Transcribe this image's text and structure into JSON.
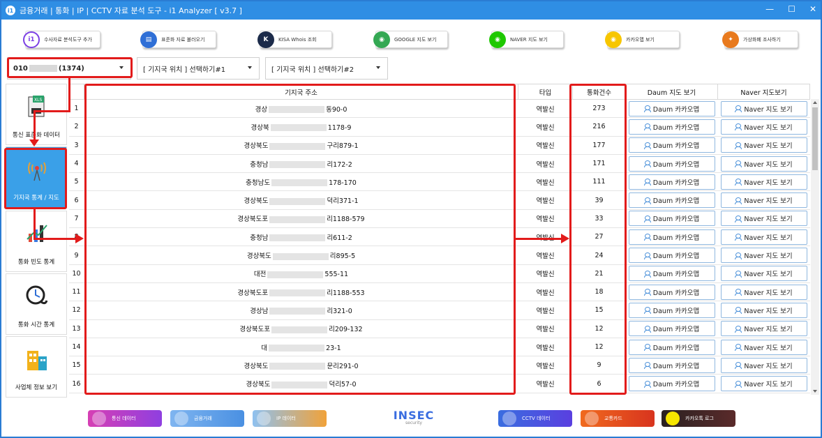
{
  "window": {
    "title": "금융거래 | 통화 | IP | CCTV 자료 분석 도구 - i1 Analyzer [ v3.7 ]",
    "app_icon": "i1",
    "controls": [
      "—",
      "☐",
      "✕"
    ]
  },
  "toolbar": {
    "buttons": [
      {
        "label": "수사자료 분석도구 추가",
        "icon": "i1-icon",
        "color": "#7b3fe4"
      },
      {
        "label": "표준화 자료 불러오기",
        "icon": "document-icon",
        "color": "#2f6fd6"
      },
      {
        "label": "KISA Whois 조회",
        "icon": "kisa-icon",
        "color": "#1c2b4a"
      },
      {
        "label": "GOOGLE 지도 보기",
        "icon": "google-maps-icon",
        "color": "#34a853"
      },
      {
        "label": "NAVER 지도 보기",
        "icon": "naver-map-icon",
        "color": "#1ec800"
      },
      {
        "label": "카카오맵 보기",
        "icon": "kakao-map-icon",
        "color": "#f7c600"
      },
      {
        "label": "가상화폐 조사하기",
        "icon": "crypto-icon",
        "color": "#e87a1e"
      }
    ]
  },
  "selectors": {
    "phone": {
      "prefix": "010",
      "suffix": "(1374)"
    },
    "station1": "[ 기지국 위치 ] 선택하기#1",
    "station2": "[ 기지국 위치 ] 선택하기#2"
  },
  "sidebar": {
    "items": [
      {
        "label": "통신 표준화 데이터",
        "icon": "xls-document-icon",
        "active": false
      },
      {
        "label": "기지국 통계 / 지도",
        "icon": "cell-tower-icon",
        "active": true
      },
      {
        "label": "통화 빈도 통계",
        "icon": "chart-icon",
        "active": false
      },
      {
        "label": "통화 시간 통계",
        "icon": "clock-phone-icon",
        "active": false
      },
      {
        "label": "사업체 정보 보기",
        "icon": "building-icon",
        "active": false
      }
    ]
  },
  "table": {
    "headers": [
      "",
      "기지국 주소",
      "타입",
      "통화건수",
      "Daum 지도 보기",
      "Naver 지도보기"
    ],
    "daum_button": "Daum 카카오맵",
    "naver_button": "Naver 지도 보기",
    "rows": [
      {
        "no": "1",
        "addr_a": "경상",
        "addr_b": "동90-0",
        "type": "역발신",
        "count": "273"
      },
      {
        "no": "2",
        "addr_a": "경상북",
        "addr_b": "1178-9",
        "type": "역발신",
        "count": "216"
      },
      {
        "no": "3",
        "addr_a": "경상북도",
        "addr_b": "구리879-1",
        "type": "역발신",
        "count": "177"
      },
      {
        "no": "4",
        "addr_a": "충청남",
        "addr_b": "리172-2",
        "type": "역발신",
        "count": "171"
      },
      {
        "no": "5",
        "addr_a": "충청남도",
        "addr_b": "178-170",
        "type": "역발신",
        "count": "111"
      },
      {
        "no": "6",
        "addr_a": "경상북도",
        "addr_b": "덕리371-1",
        "type": "역발신",
        "count": "39"
      },
      {
        "no": "7",
        "addr_a": "경상북도포",
        "addr_b": "리1188-579",
        "type": "역발신",
        "count": "33"
      },
      {
        "no": "8",
        "addr_a": "충청남",
        "addr_b": "리611-2",
        "type": "역발신",
        "count": "27"
      },
      {
        "no": "9",
        "addr_a": "경상북도",
        "addr_b": "리895-5",
        "type": "역발신",
        "count": "24"
      },
      {
        "no": "10",
        "addr_a": "대전",
        "addr_b": "555-11",
        "type": "역발신",
        "count": "21"
      },
      {
        "no": "11",
        "addr_a": "경상북도포",
        "addr_b": "리1188-553",
        "type": "역발신",
        "count": "18"
      },
      {
        "no": "12",
        "addr_a": "경상남",
        "addr_b": "리321-0",
        "type": "역발신",
        "count": "15"
      },
      {
        "no": "13",
        "addr_a": "경상북도포",
        "addr_b": "리209-132",
        "type": "역발신",
        "count": "12"
      },
      {
        "no": "14",
        "addr_a": "대",
        "addr_b": "23-1",
        "type": "역발신",
        "count": "12"
      },
      {
        "no": "15",
        "addr_a": "경상북도",
        "addr_b": "문리291-0",
        "type": "역발신",
        "count": "9"
      },
      {
        "no": "16",
        "addr_a": "경상북도",
        "addr_b": "덕리57-0",
        "type": "역발신",
        "count": "6"
      }
    ]
  },
  "bottombar": {
    "buttons": [
      {
        "label": "통신 데이터",
        "color": "#b03fd8"
      },
      {
        "label": "금융거래",
        "color": "#5aa0ea"
      },
      {
        "label": "IP 데이터",
        "color": "#f0a23a"
      },
      {
        "label": "CCTV 데이터",
        "color": "#3a6de0"
      },
      {
        "label": "교통카드",
        "color": "#e8441e"
      },
      {
        "label": "카카오톡 로그",
        "color": "#3a2a2a"
      }
    ],
    "logo": "INSEC",
    "logo_sub": "security"
  },
  "colors": {
    "accent": "#2f8ee4",
    "highlight": "#e21b1b",
    "active_side": "#3aa0e8"
  }
}
